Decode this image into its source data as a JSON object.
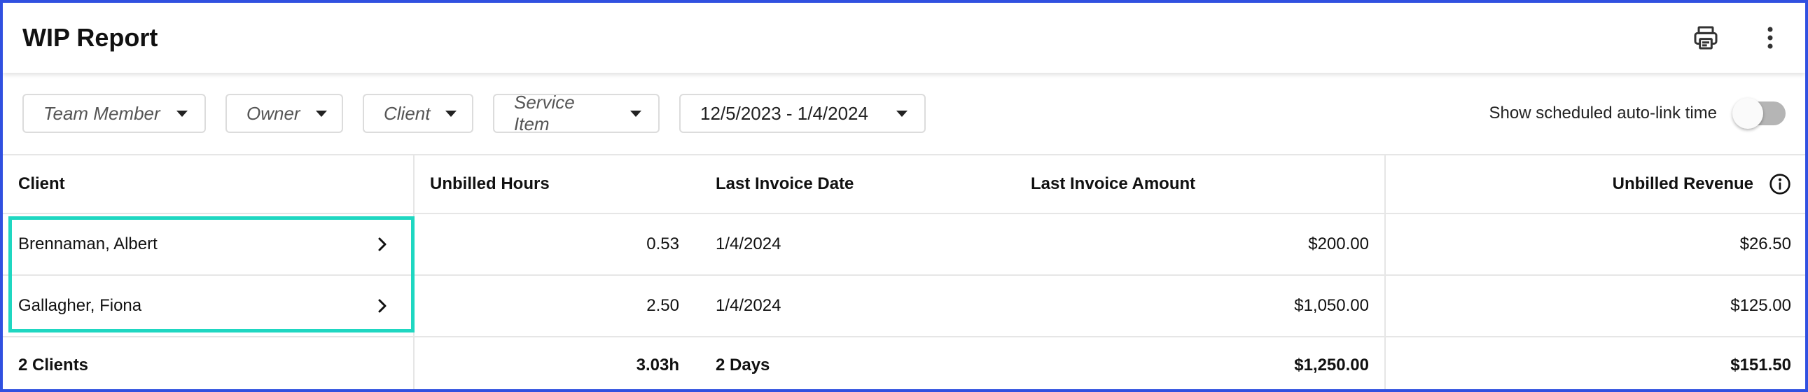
{
  "header": {
    "title": "WIP Report",
    "print_icon": "printer-icon",
    "more_icon": "more-vertical-icon"
  },
  "filters": {
    "team_member": "Team Member",
    "owner": "Owner",
    "client": "Client",
    "service_item": "Service Item",
    "date_range": "12/5/2023 - 1/4/2024",
    "toggle_label": "Show scheduled auto-link time",
    "toggle_on": false
  },
  "table": {
    "columns": {
      "client": "Client",
      "unbilled_hours": "Unbilled Hours",
      "last_invoice_date": "Last Invoice Date",
      "last_invoice_amount": "Last Invoice Amount",
      "unbilled_revenue": "Unbilled Revenue"
    },
    "rows": [
      {
        "client": "Brennaman, Albert",
        "hours": "0.53",
        "date": "1/4/2024",
        "amount": "$200.00",
        "revenue": "$26.50"
      },
      {
        "client": "Gallagher, Fiona",
        "hours": "2.50",
        "date": "1/4/2024",
        "amount": "$1,050.00",
        "revenue": "$125.00"
      }
    ],
    "totals": {
      "clients": "2 Clients",
      "hours": "3.03h",
      "date": "2 Days",
      "amount": "$1,250.00",
      "revenue": "$151.50"
    }
  },
  "colors": {
    "frame": "#3050e0",
    "highlight": "#1fd7c1",
    "toggle_track": "#b5b5b5"
  }
}
